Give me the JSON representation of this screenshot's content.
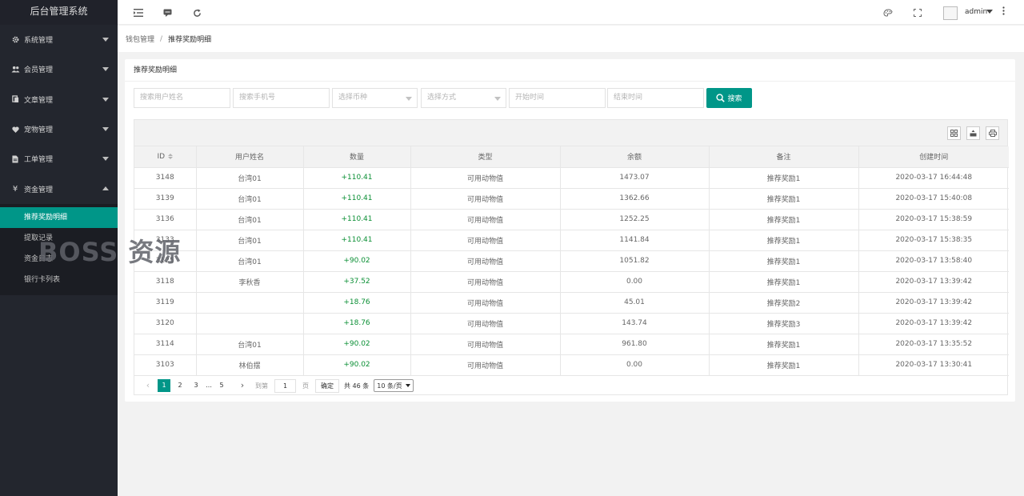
{
  "app": {
    "title": "后台管理系统"
  },
  "sidebar": {
    "items": [
      {
        "icon": "gear-icon",
        "label": "系统管理",
        "expanded": false
      },
      {
        "icon": "users-icon",
        "label": "会员管理",
        "expanded": false
      },
      {
        "icon": "document-icon",
        "label": "文章管理",
        "expanded": false
      },
      {
        "icon": "heart-icon",
        "label": "宠物管理",
        "expanded": false
      },
      {
        "icon": "file-icon",
        "label": "工单管理",
        "expanded": false
      },
      {
        "icon": "yen-icon",
        "label": "资金管理",
        "expanded": true
      }
    ],
    "sub_items": [
      "推荐奖励明细",
      "提取记录",
      "资金日志",
      "银行卡列表"
    ],
    "active_sub": "推荐奖励明细"
  },
  "header": {
    "user": "admin"
  },
  "breadcrumb": {
    "parent": "钱包管理",
    "separator": "/",
    "current": "推荐奖励明细"
  },
  "card": {
    "title": "推荐奖励明细"
  },
  "search": {
    "username_placeholder": "搜索用户姓名",
    "phone_placeholder": "搜索手机号",
    "currency_placeholder": "选择币种",
    "method_placeholder": "选择方式",
    "start_placeholder": "开始时间",
    "end_placeholder": "结束时间",
    "button_label": "搜索"
  },
  "table": {
    "columns": [
      "ID",
      "用户姓名",
      "数量",
      "类型",
      "余额",
      "备注",
      "创建时间"
    ],
    "rows": [
      [
        "3148",
        "台湾01",
        "+110.41",
        "可用动物值",
        "1473.07",
        "推荐奖励1",
        "2020-03-17 16:44:48"
      ],
      [
        "3139",
        "台湾01",
        "+110.41",
        "可用动物值",
        "1362.66",
        "推荐奖励1",
        "2020-03-17 15:40:08"
      ],
      [
        "3136",
        "台湾01",
        "+110.41",
        "可用动物值",
        "1252.25",
        "推荐奖励1",
        "2020-03-17 15:38:59"
      ],
      [
        "3133",
        "台湾01",
        "+110.41",
        "可用动物值",
        "1141.84",
        "推荐奖励1",
        "2020-03-17 15:38:35"
      ],
      [
        "3125",
        "台湾01",
        "+90.02",
        "可用动物值",
        "1051.82",
        "推荐奖励1",
        "2020-03-17 13:58:40"
      ],
      [
        "3118",
        "李秋香",
        "+37.52",
        "可用动物值",
        "0.00",
        "推荐奖励1",
        "2020-03-17 13:39:42"
      ],
      [
        "3119",
        "",
        "+18.76",
        "可用动物值",
        "45.01",
        "推荐奖励2",
        "2020-03-17 13:39:42"
      ],
      [
        "3120",
        "",
        "+18.76",
        "可用动物值",
        "143.74",
        "推荐奖励3",
        "2020-03-17 13:39:42"
      ],
      [
        "3114",
        "台湾01",
        "+90.02",
        "可用动物值",
        "961.80",
        "推荐奖励1",
        "2020-03-17 13:35:52"
      ],
      [
        "3103",
        "林伯摆",
        "+90.02",
        "可用动物值",
        "0.00",
        "推荐奖励1",
        "2020-03-17 13:30:41"
      ]
    ]
  },
  "pagination": {
    "pages": [
      "1",
      "2",
      "3",
      "…",
      "5"
    ],
    "current": "1",
    "goto_label": "到第",
    "goto_value": "1",
    "page_unit": "页",
    "confirm": "确定",
    "total": "共 46 条",
    "page_size": "10 条/页"
  },
  "watermark": "BOSS 资源",
  "colors": {
    "accent": "#009688",
    "sidebar_bg": "#23262e",
    "amount_positive": "#0a8f34"
  }
}
